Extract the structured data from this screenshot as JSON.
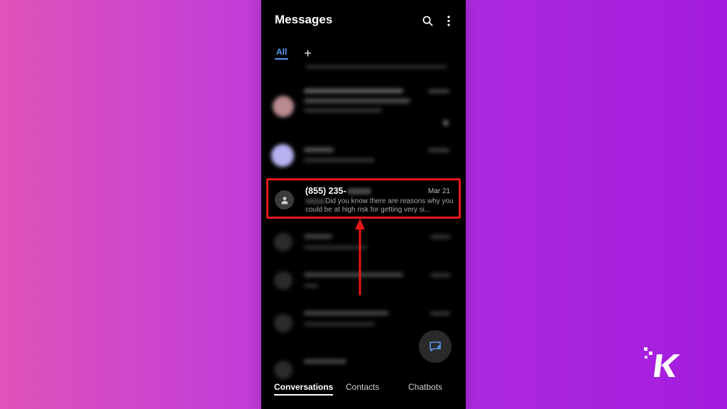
{
  "app": {
    "title": "Messages"
  },
  "tabs": {
    "all_label": "All",
    "add_label": "+"
  },
  "highlighted_conversation": {
    "name_visible": "(855) 235-",
    "date": "Mar 21",
    "preview": "Did you know there are reasons why you could be at high risk for getting very si..."
  },
  "bottom_nav": {
    "items": [
      "Conversations",
      "Contacts",
      "Chatbots"
    ],
    "active": "Conversations"
  },
  "colors": {
    "accent_blue": "#5b9cf0",
    "highlight_red": "#e81818",
    "background_left": "#e053b8",
    "background_right": "#a31cde"
  },
  "icons": {
    "search": "search-icon",
    "more": "more-vertical-icon",
    "avatar": "person-icon",
    "fab": "new-message-icon"
  }
}
